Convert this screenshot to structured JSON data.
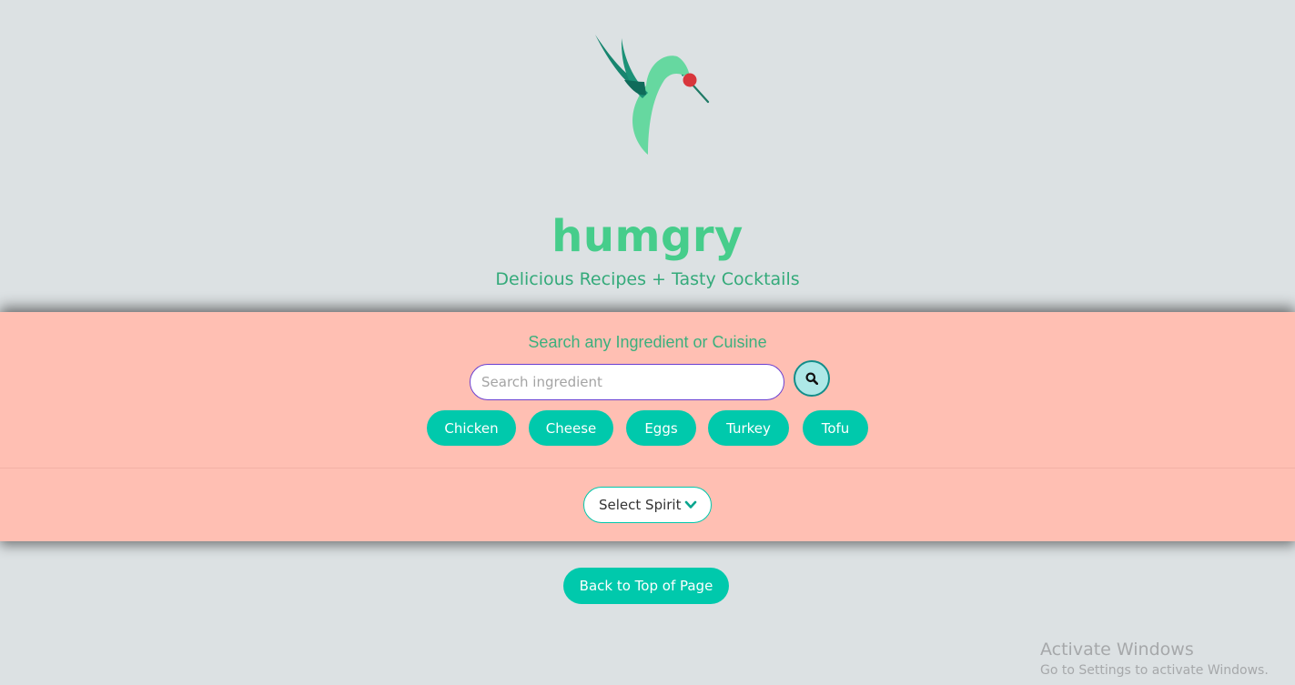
{
  "brand": {
    "title": "humgry",
    "subtitle": "Delicious Recipes + Tasty Cocktails",
    "logo_icon": "hummingbird-icon"
  },
  "search": {
    "heading": "Search any Ingredient or Cuisine",
    "placeholder": "Search ingredient",
    "value": "",
    "button_icon": "search-icon"
  },
  "ingredients": [
    {
      "label": "Chicken"
    },
    {
      "label": "Cheese"
    },
    {
      "label": "Eggs"
    },
    {
      "label": "Turkey"
    },
    {
      "label": "Tofu"
    }
  ],
  "spirit": {
    "label": "Select Spirit",
    "icon": "chevron-down-icon"
  },
  "back_to_top": "Back to Top of Page",
  "watermark": {
    "title": "Activate Windows",
    "subtitle": "Go to Settings to activate Windows."
  },
  "colors": {
    "background": "#dce1e3",
    "brand_green": "#46cd8b",
    "panel": "#ffbfb3",
    "accent": "#00c9ac",
    "input_border": "#6a3fd1"
  }
}
